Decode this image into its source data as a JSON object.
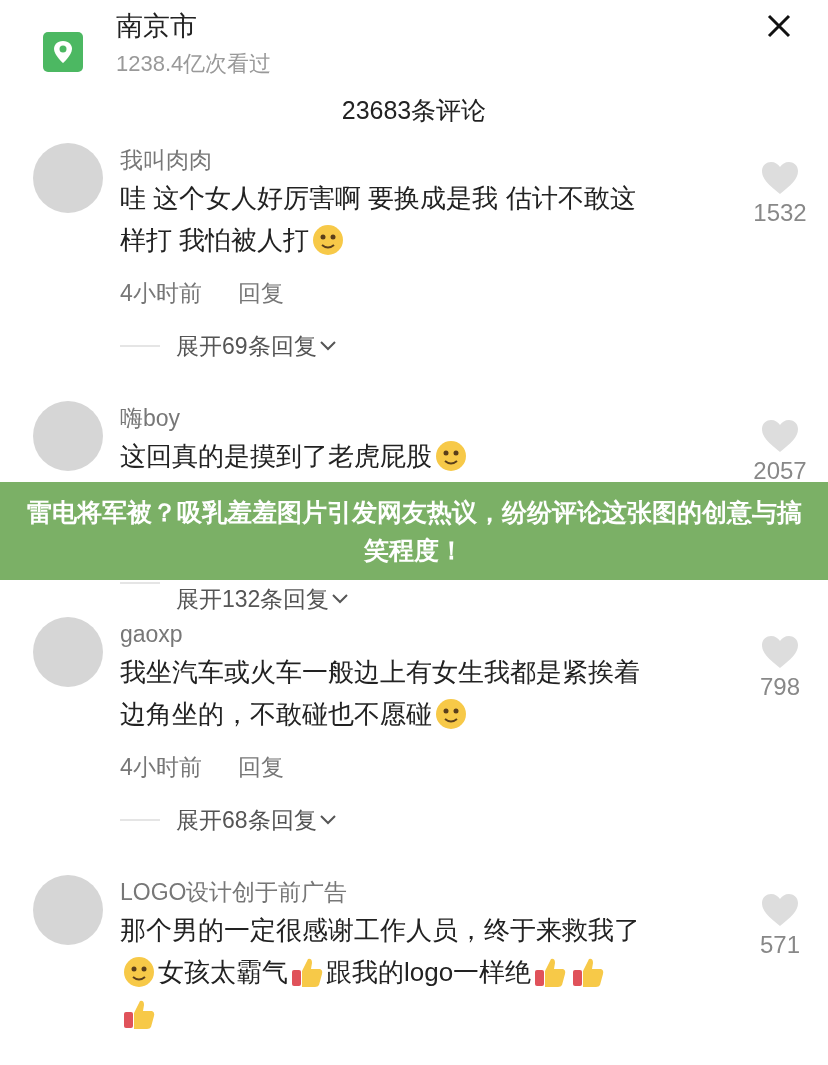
{
  "header": {
    "title": "南京市",
    "views": "1238.4亿次看过"
  },
  "comment_count": "23683条评论",
  "comments": [
    {
      "name": "我叫肉肉",
      "lines": [
        [
          {
            "kind": "text",
            "text": "哇 这个女人好厉害啊 要换成是我 估计不敢这"
          }
        ],
        [
          {
            "kind": "text",
            "text": "样打 我怕被人打"
          },
          {
            "kind": "face"
          }
        ]
      ],
      "likes": "1532",
      "time": "4小时前",
      "reply": "回复",
      "expand": "展开69条回复"
    },
    {
      "name": "嗨boy",
      "lines": [
        [
          {
            "kind": "text",
            "text": "这回真的是摸到了老虎屁股"
          },
          {
            "kind": "face"
          }
        ]
      ],
      "likes": "2057",
      "expand": "展开132条回复"
    },
    {
      "name": "gaoxp",
      "lines": [
        [
          {
            "kind": "text",
            "text": "我坐汽车或火车一般边上有女生我都是紧挨着"
          }
        ],
        [
          {
            "kind": "text",
            "text": "边角坐的，不敢碰也不愿碰"
          },
          {
            "kind": "face"
          }
        ]
      ],
      "likes": "798",
      "time": "4小时前",
      "reply": "回复",
      "expand": "展开68条回复"
    },
    {
      "name": "LOGO设计创于前广告",
      "lines": [
        [
          {
            "kind": "text",
            "text": "那个男的一定很感谢工作人员，终于来救我了"
          }
        ],
        [
          {
            "kind": "face"
          },
          {
            "kind": "text",
            "text": "女孩太霸气"
          },
          {
            "kind": "thumb"
          },
          {
            "kind": "text",
            "text": "跟我的logo一样绝"
          },
          {
            "kind": "thumb"
          },
          {
            "kind": "thumb"
          }
        ],
        [
          {
            "kind": "thumb"
          }
        ]
      ],
      "likes": "571"
    }
  ],
  "banner": {
    "text": "雷电将军被？吸乳羞羞图片引发网友热议，纷纷评论这张图的创意与搞笑程度！"
  }
}
